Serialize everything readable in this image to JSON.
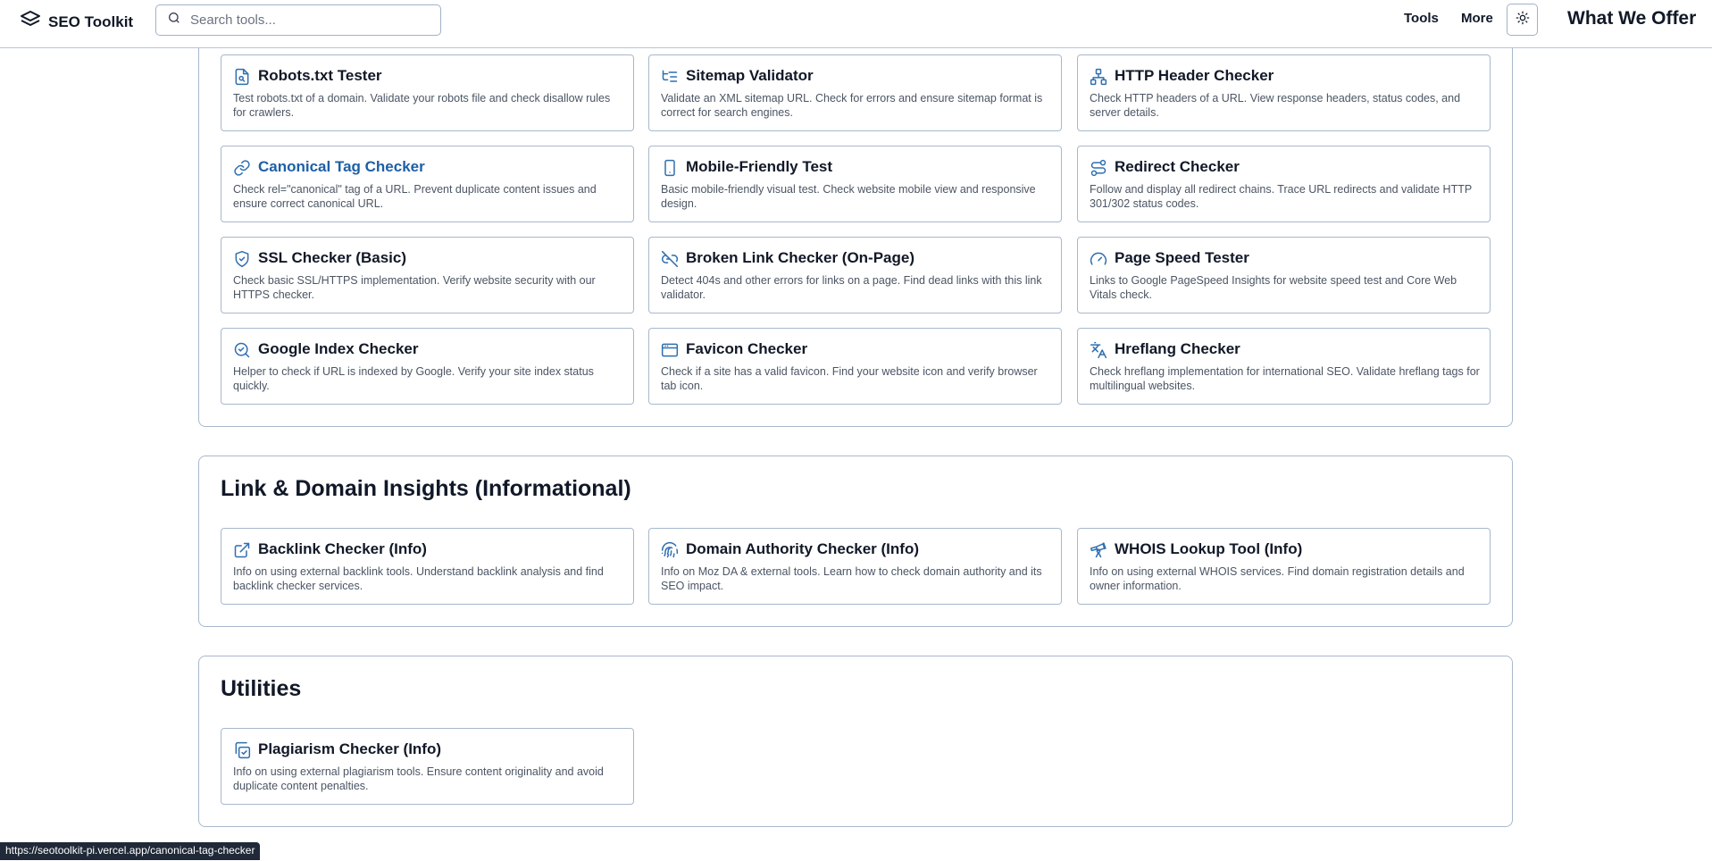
{
  "header": {
    "brand": "SEO Toolkit",
    "search_placeholder": "Search tools...",
    "nav": [
      "Tools",
      "More"
    ],
    "offer_title": "What We Offer"
  },
  "colors": {
    "border": "#a7b8cc",
    "icon": "#2f6fb0",
    "active_link": "#1d5fa6",
    "text_muted": "#4b5563"
  },
  "sections": [
    {
      "title": "",
      "cards": [
        {
          "icon": "file-search-icon",
          "title": "Robots.txt Tester",
          "desc": "Test robots.txt of a domain. Validate your robots file and check disallow rules for crawlers."
        },
        {
          "icon": "list-tree-icon",
          "title": "Sitemap Validator",
          "desc": "Validate an XML sitemap URL. Check for errors and ensure sitemap format is correct for search engines."
        },
        {
          "icon": "network-icon",
          "title": "HTTP Header Checker",
          "desc": "Check HTTP headers of a URL. View response headers, status codes, and server details."
        },
        {
          "icon": "link-icon",
          "title": "Canonical Tag Checker",
          "desc": "Check rel=\"canonical\" tag of a URL. Prevent duplicate content issues and ensure correct canonical URL."
        },
        {
          "icon": "smartphone-icon",
          "title": "Mobile-Friendly Test",
          "desc": "Basic mobile-friendly visual test. Check website mobile view and responsive design."
        },
        {
          "icon": "route-icon",
          "title": "Redirect Checker",
          "desc": "Follow and display all redirect chains. Trace URL redirects and validate HTTP 301/302 status codes."
        },
        {
          "icon": "shield-check-icon",
          "title": "SSL Checker (Basic)",
          "desc": "Check basic SSL/HTTPS implementation. Verify website security with our HTTPS checker."
        },
        {
          "icon": "unlink-icon",
          "title": "Broken Link Checker (On-Page)",
          "desc": "Detect 404s and other errors for links on a page. Find dead links with this link validator."
        },
        {
          "icon": "gauge-icon",
          "title": "Page Speed Tester",
          "desc": "Links to Google PageSpeed Insights for website speed test and Core Web Vitals check."
        },
        {
          "icon": "search-check-icon",
          "title": "Google Index Checker",
          "desc": "Helper to check if URL is indexed by Google. Verify your site index status quickly."
        },
        {
          "icon": "browser-icon",
          "title": "Favicon Checker",
          "desc": "Check if a site has a valid favicon. Find your website icon and verify browser tab icon."
        },
        {
          "icon": "languages-icon",
          "title": "Hreflang Checker",
          "desc": "Check hreflang implementation for international SEO. Validate hreflang tags for multilingual websites."
        }
      ]
    },
    {
      "title": "Link & Domain Insights (Informational)",
      "cards": [
        {
          "icon": "external-link-icon",
          "title": "Backlink Checker (Info)",
          "desc": "Info on using external backlink tools. Understand backlink analysis and find backlink checker services."
        },
        {
          "icon": "fingerprint-icon",
          "title": "Domain Authority Checker (Info)",
          "desc": "Info on Moz DA & external tools. Learn how to check domain authority and its SEO impact."
        },
        {
          "icon": "telescope-icon",
          "title": "WHOIS Lookup Tool (Info)",
          "desc": "Info on using external WHOIS services. Find domain registration details and owner information."
        }
      ]
    },
    {
      "title": "Utilities",
      "cards": [
        {
          "icon": "copy-check-icon",
          "title": "Plagiarism Checker (Info)",
          "desc": "Info on using external plagiarism tools. Ensure content originality and avoid duplicate content penalties."
        }
      ]
    }
  ],
  "status_url": "https://seotoolkit-pi.vercel.app/canonical-tag-checker"
}
